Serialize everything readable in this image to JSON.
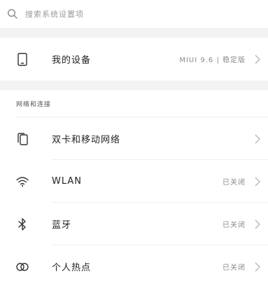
{
  "search": {
    "placeholder": "搜索系统设置项",
    "icon": "search-icon"
  },
  "device_row": {
    "label": "我的设备",
    "value": "MIUI 9.6 | 稳定版",
    "icon": "phone-icon"
  },
  "section": {
    "title": "网络和连接"
  },
  "items": [
    {
      "label": "双卡和移动网络",
      "value": "",
      "icon": "sim-cards-icon"
    },
    {
      "label": "WLAN",
      "value": "已关闭",
      "icon": "wifi-icon"
    },
    {
      "label": "蓝牙",
      "value": "已关闭",
      "icon": "bluetooth-icon"
    },
    {
      "label": "个人热点",
      "value": "已关闭",
      "icon": "hotspot-icon"
    }
  ],
  "colors": {
    "separator_band": "#f3f3f3",
    "divider": "#efefef",
    "secondary_text": "#8a8a8a"
  }
}
